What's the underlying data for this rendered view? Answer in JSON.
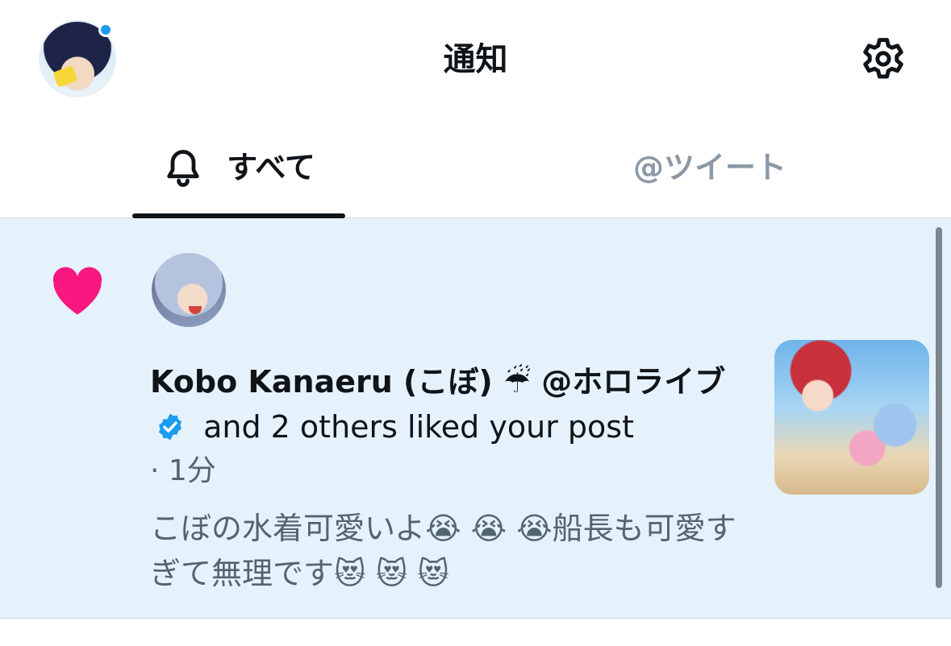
{
  "header": {
    "title": "通知",
    "avatar_icon": "user-avatar",
    "settings_icon": "gear-icon"
  },
  "tabs": [
    {
      "label": "すべて",
      "icon": "bell-icon",
      "selected": true
    },
    {
      "label": "@ツイート",
      "selected": false
    }
  ],
  "notification": {
    "type_icon": "heart-icon",
    "heart_color": "#f91880",
    "actor_name": "Kobo Kanaeru (こぼ) ☔ @ホロライブ",
    "verified_color": "#1d9bf0",
    "action_text": "and 2 others liked your post",
    "time": "· 1分",
    "post_text": "こぼの水着可愛いよ😭 😭 😭船長も可愛すぎて無理です😻 😻 😻"
  },
  "colors": {
    "accent": "#1d9bf0",
    "highlight_bg": "#e6f2fb",
    "muted_text": "#536471"
  }
}
